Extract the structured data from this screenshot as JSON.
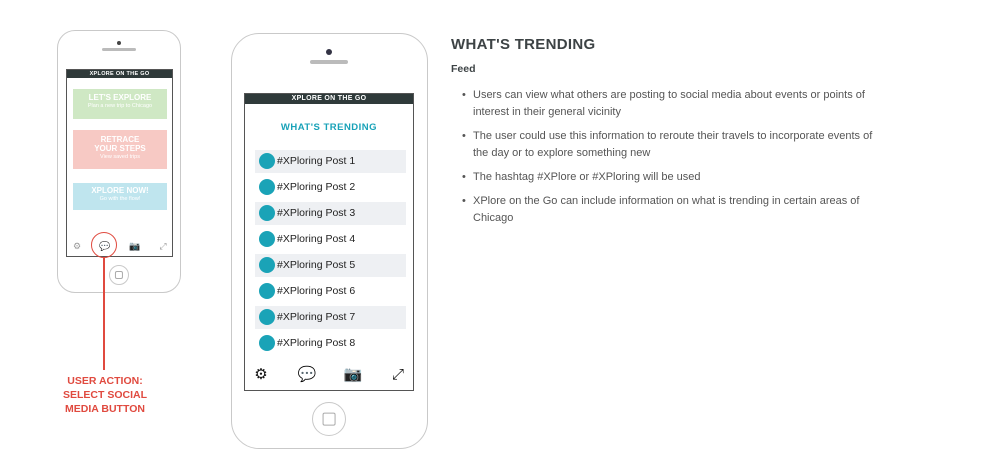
{
  "small_phone": {
    "app_title": "XPLORE ON THE GO",
    "cards": [
      {
        "title": "LET'S EXPLORE",
        "subtitle": "Plan a new trip to Chicago"
      },
      {
        "title_line1": "RETRACE",
        "title_line2": "YOUR STEPS",
        "subtitle": "View saved trips"
      },
      {
        "title": "XPLORE NOW!",
        "subtitle": "Go with the flow!"
      }
    ],
    "nav": {
      "settings_icon": "⚙",
      "chat_icon": "💬",
      "camera_icon": "📷",
      "expand_icon": "⤢"
    }
  },
  "annotation": {
    "line1": "USER ACTION:",
    "line2": "SELECT SOCIAL",
    "line3": "MEDIA BUTTON",
    "color": "#e04a3f"
  },
  "large_phone": {
    "app_title": "XPLORE ON THE GO",
    "section_title": "WHAT'S TRENDING",
    "posts": [
      "#XPloring Post 1",
      "#XPloring Post 2",
      "#XPloring Post 3",
      "#XPloring Post 4",
      "#XPloring Post 5",
      "#XPloring Post 6",
      "#XPloring Post 7",
      "#XPloring Post 8"
    ],
    "nav": {
      "settings_icon": "⚙",
      "chat_icon": "💬",
      "camera_icon": "📷",
      "expand_icon": "⤢"
    }
  },
  "description": {
    "title": "WHAT'S TRENDING",
    "subtitle": "Feed",
    "bullets": [
      "Users can view what others are posting to social media about events or points of interest in their general vicinity",
      "The user could use this information to reroute their travels to incorporate events of the day or to explore something new",
      "The hashtag #XPlore or #XPloring will be used",
      "XPlore on the Go can include information on what is trending in certain areas of Chicago"
    ]
  },
  "colors": {
    "accent": "#18a2b8",
    "header": "#2f3a3a",
    "annotation": "#e04a3f"
  }
}
